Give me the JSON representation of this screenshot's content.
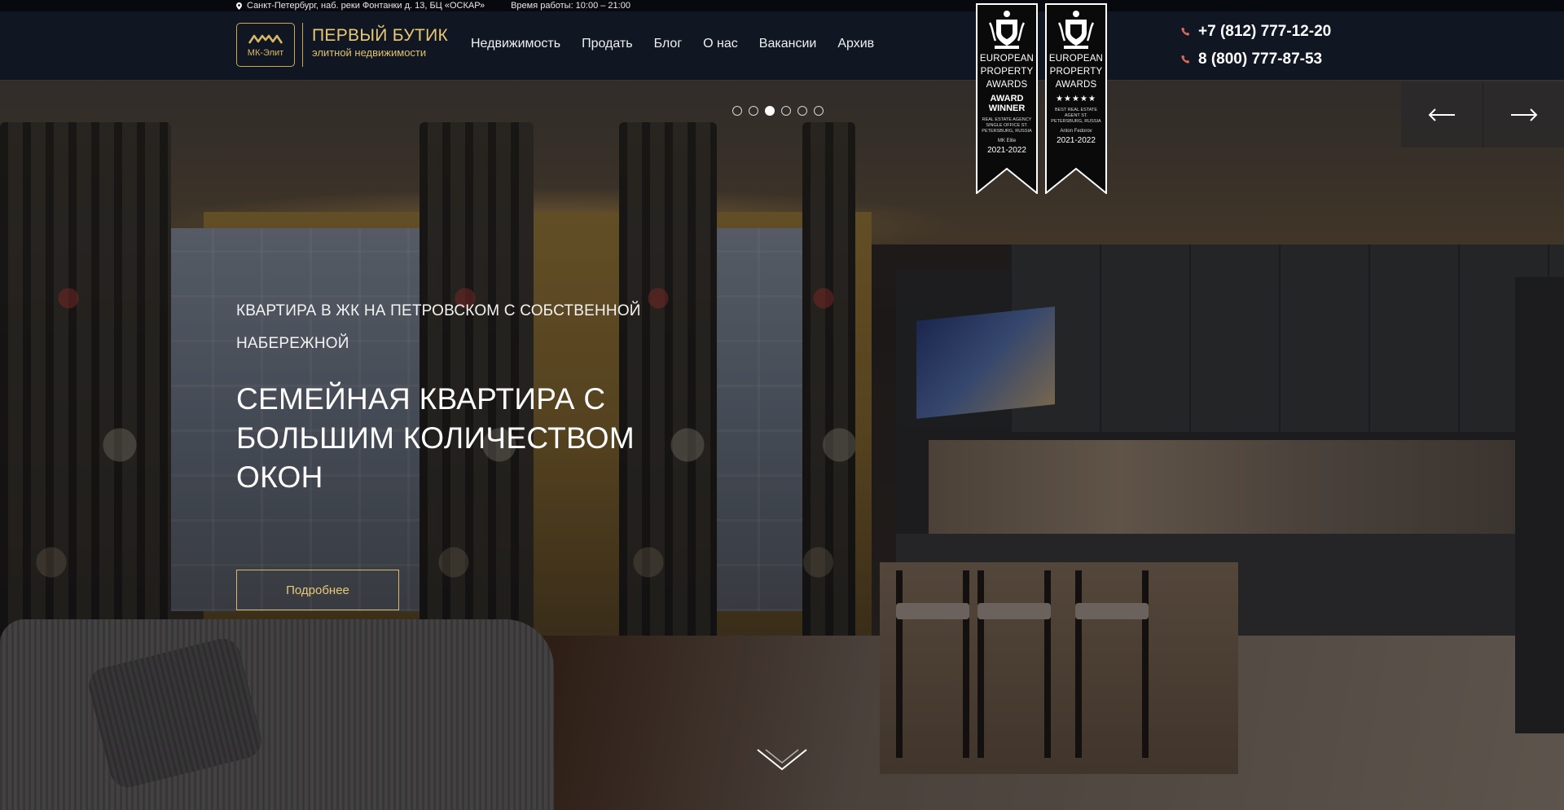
{
  "topbar": {
    "address": "Санкт-Петербург, наб. реки Фонтанки д. 13, БЦ «ОСКАР»",
    "hours": "Время работы: 10:00 – 21:00"
  },
  "header": {
    "logo_text": "МК-Элит",
    "brand_title": "ПЕРВЫЙ БУТИК",
    "brand_subtitle": "элитной недвижимости",
    "nav": [
      "Недвижимость",
      "Продать",
      "Блог",
      "О нас",
      "Вакансии",
      "Архив"
    ],
    "phones": [
      "+7 (812) 777-12-20",
      "8 (800) 777-87-53"
    ]
  },
  "awards": [
    {
      "line1": "EUROPEAN",
      "line2": "PROPERTY",
      "line3": "AWARDS",
      "kind": "AWARD WINNER",
      "small": "REAL ESTATE AGENCY SINGLE OFFICE ST. PETERSBURG, RUSSIA",
      "name": "MK Elite",
      "year": "2021-2022"
    },
    {
      "line1": "EUROPEAN",
      "line2": "PROPERTY",
      "line3": "AWARDS",
      "stars": "★★★★★",
      "small": "BEST REAL ESTATE AGENT ST. PETERSBURG, RUSSIA",
      "name": "Anton Fedorov",
      "year": "2021-2022"
    }
  ],
  "slider": {
    "total": 6,
    "active_index": 3
  },
  "hero": {
    "subtitle": "КВАРТИРА В ЖК НА ПЕТРОВСКОМ С СОБСТВЕННОЙ НАБЕРЕЖНОЙ",
    "title": "СЕМЕЙНАЯ КВАРТИРА С БОЛЬШИМ КОЛИЧЕСТВОМ ОКОН",
    "button": "Подробнее"
  },
  "colors": {
    "accent_gold": "#d9b968",
    "header_bg": "#101722",
    "phone_icon": "#e06b5a"
  },
  "icons": [
    "map-pin-icon",
    "phone-icon",
    "arrow-left-icon",
    "arrow-right-icon",
    "chevron-down-icon",
    "crest-icon"
  ]
}
